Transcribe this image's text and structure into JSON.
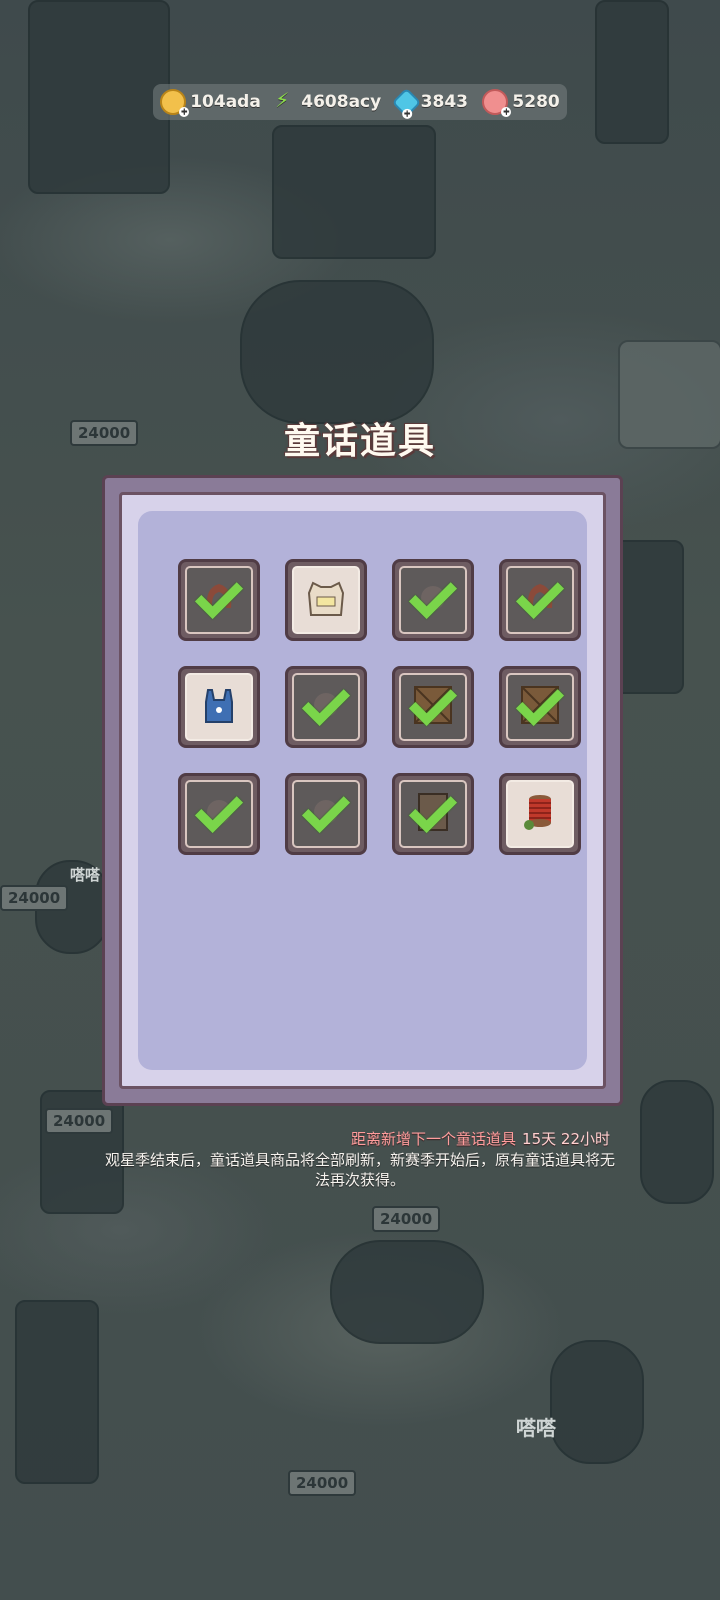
{
  "currencies": [
    {
      "icon": "coin-icon",
      "value": "104ada",
      "color": "#f2c04b"
    },
    {
      "icon": "energy-bolt-icon",
      "value": "4608acy",
      "color": "#8ce04a"
    },
    {
      "icon": "gem-icon",
      "value": "3843",
      "color": "#4fc6e6"
    },
    {
      "icon": "shell-icon",
      "value": "5280",
      "color": "#f08f8f"
    }
  ],
  "background_signs": [
    "24000",
    "24000",
    "24000",
    "24000",
    "24000",
    "嗒嗒",
    "嗒嗒"
  ],
  "title": "童话道具",
  "items": [
    {
      "icon": "hair-icon",
      "owned": true
    },
    {
      "icon": "vest-icon",
      "owned": false
    },
    {
      "icon": "item-icon",
      "owned": true
    },
    {
      "icon": "hair-icon",
      "owned": true
    },
    {
      "icon": "overalls-icon",
      "owned": false
    },
    {
      "icon": "item-icon",
      "owned": true
    },
    {
      "icon": "crate-icon",
      "owned": true
    },
    {
      "icon": "crate-icon",
      "owned": true
    },
    {
      "icon": "item-icon",
      "owned": true
    },
    {
      "icon": "item-icon",
      "owned": true
    },
    {
      "icon": "furniture-icon",
      "owned": true
    },
    {
      "icon": "thread-spool-icon",
      "owned": false
    }
  ],
  "countdown": {
    "label": "距离新增下一个童话道具",
    "time": "15天 22小时"
  },
  "notice": "观星季结束后，童话道具商品将全部刷新，新赛季开始后，原有童话道具将无法再次获得。"
}
